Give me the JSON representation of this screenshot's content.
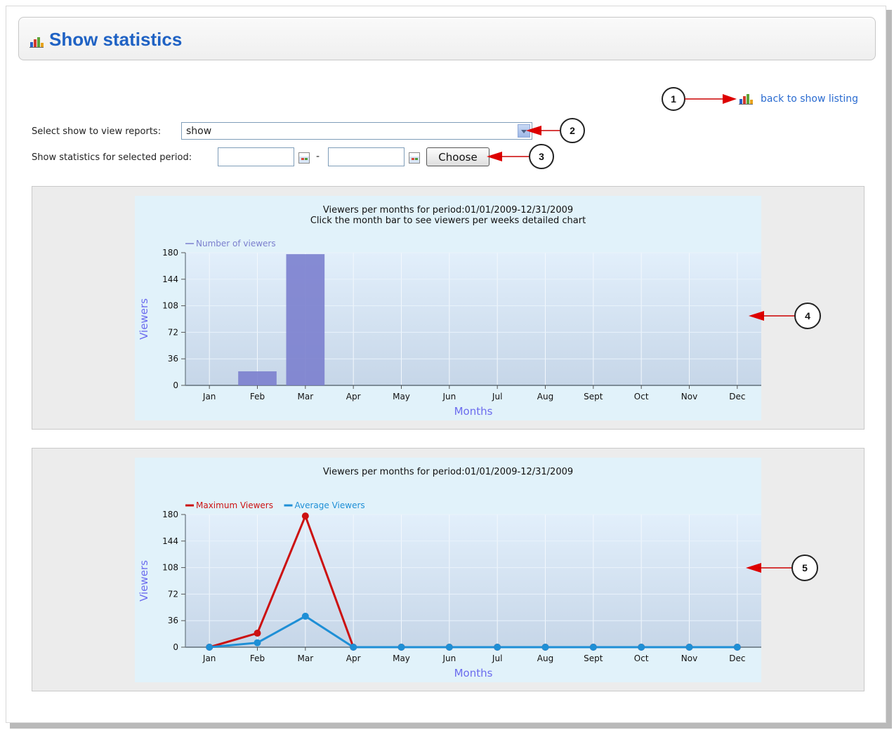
{
  "header": {
    "title": "Show statistics",
    "icon": "bar-chart-icon"
  },
  "nav": {
    "back_link": "back to show listing",
    "back_icon": "bar-chart-icon"
  },
  "filters": {
    "show_label": "Select show to view reports:",
    "show_value": "show",
    "period_label": "Show statistics for selected period:",
    "start_date": "",
    "end_date": "",
    "separator": "-",
    "choose_label": "Choose"
  },
  "callouts": [
    "1",
    "2",
    "3",
    "4",
    "5"
  ],
  "chart_data": [
    {
      "type": "bar",
      "title": "Viewers per months for period:01/01/2009-12/31/2009",
      "subtitle": "Click the month bar to see viewers per weeks detailed chart",
      "xlabel": "Months",
      "ylabel": "Viewers",
      "categories": [
        "Jan",
        "Feb",
        "Mar",
        "Apr",
        "May",
        "Jun",
        "Jul",
        "Aug",
        "Sept",
        "Oct",
        "Nov",
        "Dec"
      ],
      "series": [
        {
          "name": "Number of viewers",
          "color": "#7b7fce",
          "values": [
            0,
            19,
            178,
            0,
            0,
            0,
            0,
            0,
            0,
            0,
            0,
            0
          ]
        }
      ],
      "yticks": [
        0,
        36,
        72,
        108,
        144,
        180
      ],
      "ylim": [
        0,
        180
      ],
      "grid": true,
      "legend": "top-left"
    },
    {
      "type": "line",
      "title": "Viewers per months for period:01/01/2009-12/31/2009",
      "xlabel": "Months",
      "ylabel": "Viewers",
      "categories": [
        "Jan",
        "Feb",
        "Mar",
        "Apr",
        "May",
        "Jun",
        "Jul",
        "Aug",
        "Sept",
        "Oct",
        "Nov",
        "Dec"
      ],
      "series": [
        {
          "name": "Maximum Viewers",
          "color": "#cc1111",
          "values": [
            0,
            19,
            178,
            0,
            0,
            0,
            0,
            0,
            0,
            0,
            0,
            0
          ]
        },
        {
          "name": "Average Viewers",
          "color": "#1e8fd6",
          "values": [
            0,
            6,
            42,
            0,
            0,
            0,
            0,
            0,
            0,
            0,
            0,
            0
          ]
        }
      ],
      "yticks": [
        0,
        36,
        72,
        108,
        144,
        180
      ],
      "ylim": [
        0,
        180
      ],
      "grid": true,
      "legend": "top-left"
    }
  ]
}
